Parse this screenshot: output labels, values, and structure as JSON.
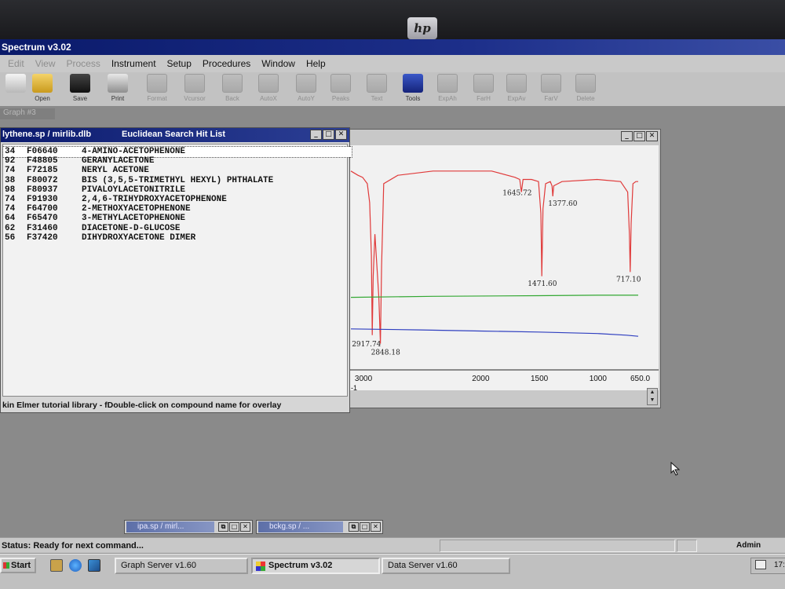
{
  "app": {
    "title": "Spectrum v3.02"
  },
  "menu": [
    {
      "label": "Edit",
      "enabled": false
    },
    {
      "label": "View",
      "enabled": false
    },
    {
      "label": "Process",
      "enabled": false
    },
    {
      "label": "Instrument",
      "enabled": true
    },
    {
      "label": "Setup",
      "enabled": true
    },
    {
      "label": "Procedures",
      "enabled": true
    },
    {
      "label": "Window",
      "enabled": true
    },
    {
      "label": "Help",
      "enabled": true
    }
  ],
  "toolbar": [
    {
      "name": "new",
      "label": "",
      "icon": "notepad-icon",
      "enabled": true
    },
    {
      "name": "open",
      "label": "Open",
      "icon": "folder-icon",
      "enabled": true
    },
    {
      "name": "save",
      "label": "Save",
      "icon": "save-icon",
      "enabled": true
    },
    {
      "name": "print",
      "label": "Print",
      "icon": "printer-icon",
      "enabled": true
    },
    {
      "name": "format",
      "label": "Format",
      "icon": "format-icon",
      "enabled": false
    },
    {
      "name": "vcursor",
      "label": "Vcursor",
      "icon": "cursor-icon",
      "enabled": false
    },
    {
      "name": "back",
      "label": "Back",
      "icon": "back-icon",
      "enabled": false
    },
    {
      "name": "autox",
      "label": "AutoX",
      "icon": "autox-icon",
      "enabled": false
    },
    {
      "name": "autoy",
      "label": "AutoY",
      "icon": "autoy-icon",
      "enabled": false
    },
    {
      "name": "peaks",
      "label": "Peaks",
      "icon": "peaks-icon",
      "enabled": false
    },
    {
      "name": "text",
      "label": "Text",
      "icon": "text-icon",
      "enabled": false
    },
    {
      "name": "tools",
      "label": "Tools",
      "icon": "toolbox-icon",
      "enabled": true
    },
    {
      "name": "expand",
      "label": "ExpAh",
      "icon": "expand-icon",
      "enabled": false
    },
    {
      "name": "farh",
      "label": "FarH",
      "icon": "farh-icon",
      "enabled": false
    },
    {
      "name": "expav",
      "label": "ExpAv",
      "icon": "expav-icon",
      "enabled": false
    },
    {
      "name": "farv",
      "label": "FarV",
      "icon": "farv-icon",
      "enabled": false
    },
    {
      "name": "delete",
      "label": "Delete",
      "icon": "recycle-icon",
      "enabled": false
    }
  ],
  "graph_tab": "Graph #3",
  "hitlist": {
    "file": "lythene.sp / mirlib.dlb",
    "title": "Euclidean Search Hit List",
    "rows": [
      {
        "score": "34",
        "id": "F06640",
        "name": "4-AMINO-ACETOPHENONE",
        "selected": true
      },
      {
        "score": "92",
        "id": "F48805",
        "name": "GERANYLACETONE",
        "selected": false
      },
      {
        "score": "74",
        "id": "F72185",
        "name": "NERYL ACETONE",
        "selected": false
      },
      {
        "score": "38",
        "id": "F80072",
        "name": "BIS (3,5,5-TRIMETHYL HEXYL) PHTHALATE",
        "selected": false
      },
      {
        "score": "98",
        "id": "F80937",
        "name": "PIVALOYLACETONITRILE",
        "selected": false
      },
      {
        "score": "74",
        "id": "F91930",
        "name": "2,4,6-TRIHYDROXYACETOPHENONE",
        "selected": false
      },
      {
        "score": "74",
        "id": "F64700",
        "name": "2-METHOXYACETOPHENONE",
        "selected": false
      },
      {
        "score": "64",
        "id": "F65470",
        "name": "3-METHYLACETOPHENONE",
        "selected": false
      },
      {
        "score": "62",
        "id": "F31460",
        "name": "DIACETONE-D-GLUCOSE",
        "selected": false
      },
      {
        "score": "56",
        "id": "F37420",
        "name": "DIHYDROXYACETONE DIMER",
        "selected": false
      }
    ],
    "status": "kin Elmer tutorial library - fDouble-click on compound name for overlay"
  },
  "graph": {
    "x_axis_suffix": "-1"
  },
  "chart_data": {
    "type": "line",
    "x_reversed": true,
    "xlim": [
      3100,
      650
    ],
    "ylim": [
      0,
      100
    ],
    "x_ticks": [
      {
        "value": 3000,
        "label": "3000"
      },
      {
        "value": 2000,
        "label": "2000"
      },
      {
        "value": 1500,
        "label": "1500"
      },
      {
        "value": 1000,
        "label": "1000"
      },
      {
        "value": 650,
        "label": "650.0"
      }
    ],
    "series": [
      {
        "color": "#e03a3a",
        "points": [
          [
            3100,
            90
          ],
          [
            3040,
            88
          ],
          [
            3000,
            87
          ],
          [
            2960,
            84
          ],
          [
            2940,
            75
          ],
          [
            2925,
            50
          ],
          [
            2918,
            12
          ],
          [
            2910,
            40
          ],
          [
            2895,
            60
          ],
          [
            2862,
            30
          ],
          [
            2848,
            8
          ],
          [
            2838,
            45
          ],
          [
            2820,
            84
          ],
          [
            2700,
            88
          ],
          [
            2400,
            90
          ],
          [
            2100,
            90
          ],
          [
            1900,
            90
          ],
          [
            1700,
            87
          ],
          [
            1660,
            86
          ],
          [
            1646,
            80
          ],
          [
            1632,
            86
          ],
          [
            1560,
            86
          ],
          [
            1500,
            85
          ],
          [
            1480,
            70
          ],
          [
            1472,
            40
          ],
          [
            1462,
            72
          ],
          [
            1440,
            84
          ],
          [
            1400,
            85
          ],
          [
            1385,
            83
          ],
          [
            1378,
            78
          ],
          [
            1370,
            83
          ],
          [
            1300,
            85
          ],
          [
            1000,
            86
          ],
          [
            800,
            85
          ],
          [
            740,
            80
          ],
          [
            725,
            60
          ],
          [
            718,
            42
          ],
          [
            710,
            65
          ],
          [
            695,
            84
          ],
          [
            670,
            85
          ],
          [
            650,
            85
          ]
        ]
      },
      {
        "color": "#33a833",
        "points": [
          [
            3100,
            30
          ],
          [
            2400,
            30.5
          ],
          [
            1500,
            30.8
          ],
          [
            1000,
            31
          ],
          [
            650,
            31
          ]
        ]
      },
      {
        "color": "#2f3fc0",
        "points": [
          [
            3100,
            15
          ],
          [
            2500,
            14.5
          ],
          [
            2000,
            14
          ],
          [
            1500,
            13.5
          ],
          [
            1000,
            12.8
          ],
          [
            750,
            12
          ],
          [
            650,
            11.5
          ]
        ]
      }
    ],
    "peak_labels": [
      {
        "x": 2917.74,
        "y": 12,
        "text": "2917.74"
      },
      {
        "x": 2848.18,
        "y": 8,
        "text": "2848.18"
      },
      {
        "x": 1645.72,
        "y": 80,
        "text": "1645.72"
      },
      {
        "x": 1471.6,
        "y": 40,
        "text": "1471.60"
      },
      {
        "x": 1377.6,
        "y": 78,
        "text": "1377.60"
      },
      {
        "x": 717.1,
        "y": 42,
        "text": "717.10"
      }
    ]
  },
  "minimized_windows": [
    {
      "title": "ipa.sp / mirl..."
    },
    {
      "title": "bckg.sp / ..."
    }
  ],
  "status": {
    "text": "Status: Ready for next command...",
    "user": "Admin"
  },
  "taskbar": {
    "start_label": "Start",
    "buttons": [
      {
        "label": "Graph Server v1.60",
        "active": false
      },
      {
        "label": "Spectrum v3.02",
        "active": true
      },
      {
        "label": "Data Server v1.60",
        "active": false
      }
    ],
    "clock": "17:"
  },
  "colors": {
    "titlebar_active": "#0c1b6e",
    "series_red": "#e03a3a",
    "series_green": "#33a833",
    "series_blue": "#2f3fc0"
  }
}
